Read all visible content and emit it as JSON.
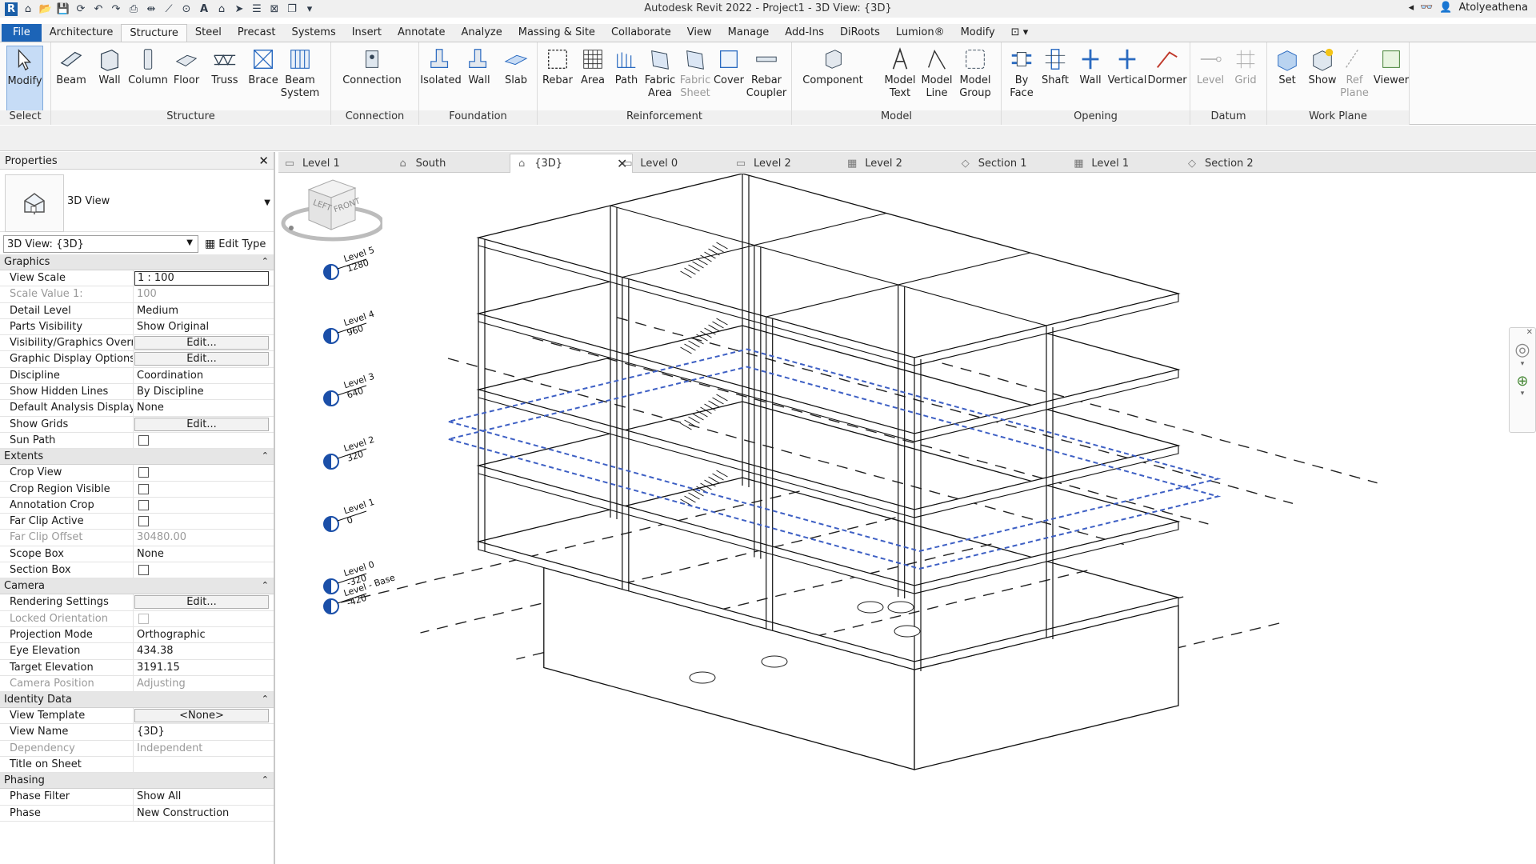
{
  "window": {
    "title": "Autodesk Revit 2022 - Project1 - 3D View: {3D}",
    "user": "Atolyeathena"
  },
  "ribbon_tabs": [
    "File",
    "Architecture",
    "Structure",
    "Steel",
    "Precast",
    "Systems",
    "Insert",
    "Annotate",
    "Analyze",
    "Massing & Site",
    "Collaborate",
    "View",
    "Manage",
    "Add-Ins",
    "DiRoots",
    "Lumion®",
    "Modify"
  ],
  "active_tab": "Structure",
  "ribbon": {
    "select": {
      "label": "Select",
      "buttons": [
        "Modify"
      ]
    },
    "structure": {
      "label": "Structure",
      "buttons": [
        "Beam",
        "Wall",
        "Column",
        "Floor",
        "Truss",
        "Brace",
        "Beam\nSystem"
      ]
    },
    "connection": {
      "label": "Connection",
      "buttons": [
        "Connection"
      ]
    },
    "foundation": {
      "label": "Foundation",
      "buttons": [
        "Isolated",
        "Wall",
        "Slab"
      ]
    },
    "reinforcement": {
      "label": "Reinforcement",
      "buttons": [
        "Rebar",
        "Area",
        "Path",
        "Fabric\nArea",
        "Fabric\nSheet",
        "Cover",
        "Rebar\nCoupler"
      ]
    },
    "model": {
      "label": "Model",
      "buttons": [
        "Component",
        "Model\nText",
        "Model\nLine",
        "Model\nGroup"
      ]
    },
    "opening": {
      "label": "Opening",
      "buttons": [
        "By\nFace",
        "Shaft",
        "Wall",
        "Vertical",
        "Dormer"
      ]
    },
    "datum": {
      "label": "Datum",
      "buttons": [
        "Level",
        "Grid"
      ]
    },
    "workplane": {
      "label": "Work Plane",
      "buttons": [
        "Set",
        "Show",
        "Ref\nPlane",
        "Viewer"
      ]
    }
  },
  "properties": {
    "title": "Properties",
    "type_name": "3D View",
    "instance": "3D View: {3D}",
    "edit_type": "Edit Type",
    "groups": [
      {
        "name": "Graphics",
        "rows": [
          {
            "name": "View Scale",
            "value": "1 : 100",
            "kind": "input"
          },
          {
            "name": "Scale Value    1:",
            "value": "100",
            "kind": "text",
            "dim": true
          },
          {
            "name": "Detail Level",
            "value": "Medium",
            "kind": "text"
          },
          {
            "name": "Parts Visibility",
            "value": "Show Original",
            "kind": "text"
          },
          {
            "name": "Visibility/Graphics Overr...",
            "value": "Edit...",
            "kind": "button"
          },
          {
            "name": "Graphic Display Options",
            "value": "Edit...",
            "kind": "button"
          },
          {
            "name": "Discipline",
            "value": "Coordination",
            "kind": "text"
          },
          {
            "name": "Show Hidden Lines",
            "value": "By Discipline",
            "kind": "text"
          },
          {
            "name": "Default Analysis Display...",
            "value": "None",
            "kind": "text"
          },
          {
            "name": "Show Grids",
            "value": "Edit...",
            "kind": "button"
          },
          {
            "name": "Sun Path",
            "value": "",
            "kind": "checkbox"
          }
        ]
      },
      {
        "name": "Extents",
        "rows": [
          {
            "name": "Crop View",
            "value": "",
            "kind": "checkbox"
          },
          {
            "name": "Crop Region Visible",
            "value": "",
            "kind": "checkbox"
          },
          {
            "name": "Annotation Crop",
            "value": "",
            "kind": "checkbox"
          },
          {
            "name": "Far Clip Active",
            "value": "",
            "kind": "checkbox"
          },
          {
            "name": "Far Clip Offset",
            "value": "30480.00",
            "kind": "text",
            "dim": true
          },
          {
            "name": "Scope Box",
            "value": "None",
            "kind": "text"
          },
          {
            "name": "Section Box",
            "value": "",
            "kind": "checkbox"
          }
        ]
      },
      {
        "name": "Camera",
        "rows": [
          {
            "name": "Rendering Settings",
            "value": "Edit...",
            "kind": "button"
          },
          {
            "name": "Locked Orientation",
            "value": "",
            "kind": "checkbox",
            "dim": true
          },
          {
            "name": "Projection Mode",
            "value": "Orthographic",
            "kind": "text"
          },
          {
            "name": "Eye Elevation",
            "value": "434.38",
            "kind": "text"
          },
          {
            "name": "Target Elevation",
            "value": "3191.15",
            "kind": "text"
          },
          {
            "name": "Camera Position",
            "value": "Adjusting",
            "kind": "text",
            "dim": true
          }
        ]
      },
      {
        "name": "Identity Data",
        "rows": [
          {
            "name": "View Template",
            "value": "<None>",
            "kind": "button"
          },
          {
            "name": "View Name",
            "value": "{3D}",
            "kind": "text"
          },
          {
            "name": "Dependency",
            "value": "Independent",
            "kind": "text",
            "dim": true
          },
          {
            "name": "Title on Sheet",
            "value": "",
            "kind": "text"
          }
        ]
      },
      {
        "name": "Phasing",
        "rows": [
          {
            "name": "Phase Filter",
            "value": "Show All",
            "kind": "text"
          },
          {
            "name": "Phase",
            "value": "New Construction",
            "kind": "text"
          }
        ]
      }
    ]
  },
  "view_tabs": [
    {
      "label": "Level 1",
      "icon": "floor-plan-icon"
    },
    {
      "label": "South",
      "icon": "elevation-icon"
    },
    {
      "label": "{3D}",
      "icon": "3d-view-icon",
      "active": true
    },
    {
      "label": "Level 0",
      "icon": "floor-plan-icon"
    },
    {
      "label": "Level 2",
      "icon": "ceiling-plan-icon"
    },
    {
      "label": "Level 2",
      "icon": "structural-plan-icon"
    },
    {
      "label": "Section 1",
      "icon": "section-icon"
    },
    {
      "label": "Level 1",
      "icon": "structural-plan-icon"
    },
    {
      "label": "Section 2",
      "icon": "section-icon"
    }
  ],
  "levels": [
    {
      "name": "Level 5",
      "elevation": "1280"
    },
    {
      "name": "Level 4",
      "elevation": "960"
    },
    {
      "name": "Level 3",
      "elevation": "640"
    },
    {
      "name": "Level 2",
      "elevation": "320"
    },
    {
      "name": "Level 1",
      "elevation": "0"
    },
    {
      "name": "Level 0",
      "elevation": "-320"
    },
    {
      "name": "Level - Base",
      "elevation": "-420"
    }
  ],
  "viewcube": {
    "left": "LEFT",
    "front": "FRONT"
  },
  "colors": {
    "accent": "#1c64b7",
    "selection": "#3d5fc4"
  }
}
